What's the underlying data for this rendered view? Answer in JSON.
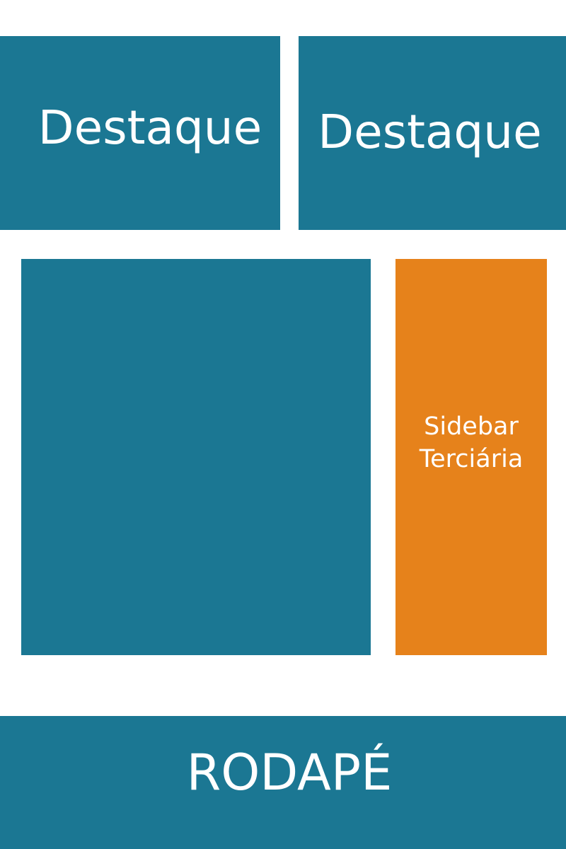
{
  "colors": {
    "primary": "#1b7793",
    "accent": "#e6821b",
    "background": "#ffffff",
    "text": "#ffffff"
  },
  "features": [
    {
      "label": "Destaque"
    },
    {
      "label": "Destaque"
    }
  ],
  "main": {
    "label": ""
  },
  "sidebar": {
    "label_lines": [
      "Sidebar",
      "Terciária"
    ]
  },
  "footer": {
    "label": "RODAPÉ"
  }
}
